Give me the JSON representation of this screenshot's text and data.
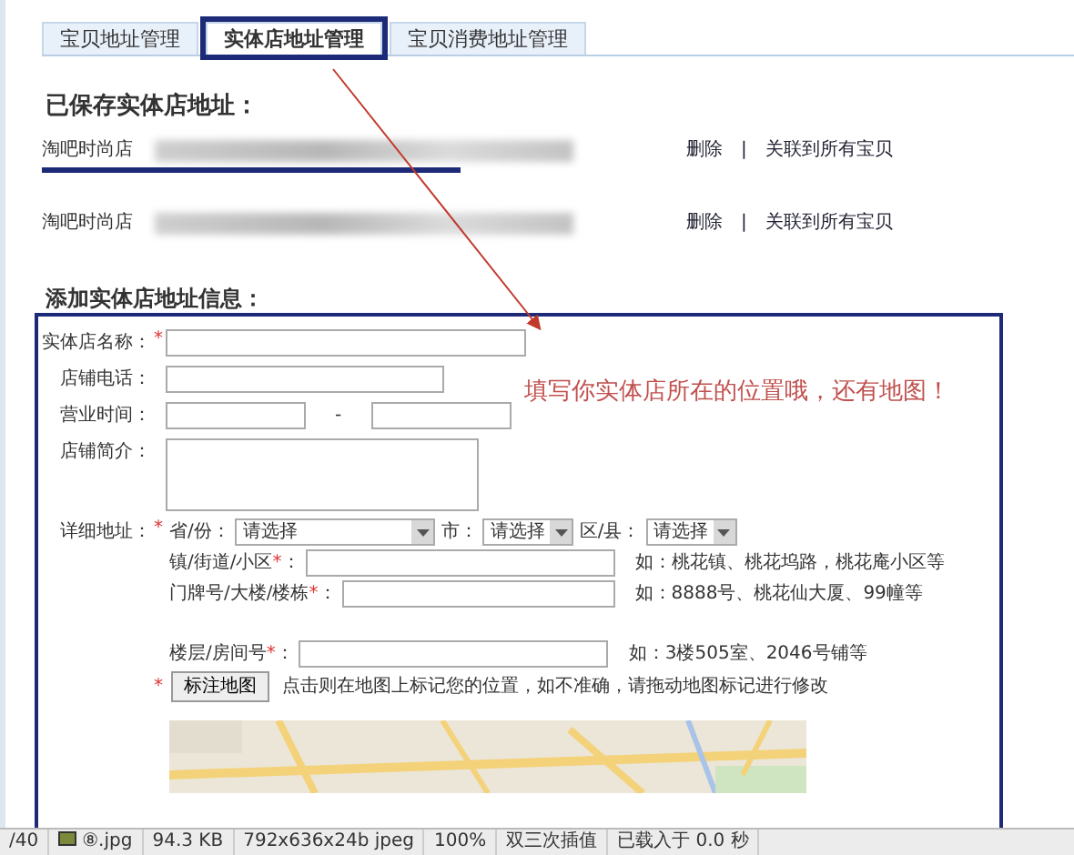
{
  "tabs": [
    {
      "label": "宝贝地址管理",
      "selected": false
    },
    {
      "label": "实体店地址管理",
      "selected": true
    },
    {
      "label": "宝贝消费地址管理",
      "selected": false
    }
  ],
  "saved": {
    "title": "已保存实体店地址：",
    "separator": "|",
    "rows": [
      {
        "name": "淘吧时尚店",
        "address_blurred": true,
        "underlined": true,
        "actions": [
          "删除",
          "关联到所有宝贝"
        ]
      },
      {
        "name": "淘吧时尚店",
        "address_blurred": true,
        "underlined": false,
        "actions": [
          "删除",
          "关联到所有宝贝"
        ]
      }
    ]
  },
  "form": {
    "title": "添加实体店地址信息：",
    "annotation": "填写你实体店所在的位置哦，还有地图！",
    "fields": [
      {
        "kind": "text",
        "label": "实体店名称：",
        "required_mark": "*"
      },
      {
        "kind": "text",
        "label": "店铺电话："
      },
      {
        "kind": "range",
        "label": "营业时间：",
        "separator": "-"
      },
      {
        "kind": "textarea",
        "label": "店铺简介："
      },
      {
        "kind": "address",
        "label": "详细地址：",
        "required_mark": "*",
        "selects": [
          {
            "label": "省/份：",
            "value": "请选择"
          },
          {
            "label": "市：",
            "value": "请选择"
          },
          {
            "label": "区/县：",
            "value": "请选择"
          }
        ],
        "lines": [
          {
            "label": "镇/街道/小区",
            "required_mark": "*",
            "colon": "：",
            "hint": "如：桃花镇、桃花坞路，桃花庵小区等"
          },
          {
            "label": "门牌号/大楼/楼栋",
            "required_mark": "*",
            "colon": "：",
            "hint": "如：8888号、桃花仙大厦、99幢等"
          },
          {
            "label": "楼层/房间号",
            "required_mark": "*",
            "colon": "：",
            "hint": "如：3楼505室、2046号铺等"
          }
        ],
        "map_button": {
          "label": "标注地图",
          "required_mark": "*",
          "hint": "点击则在地图上标记您的位置，如不准确，请拖动地图标记进行修改"
        }
      }
    ]
  },
  "status_bar": {
    "items": [
      "/40",
      "⑧.jpg",
      "94.3 KB",
      "792x636x24b jpeg",
      "100%",
      "双三次插值",
      "已载入于 0.0 秒"
    ]
  }
}
